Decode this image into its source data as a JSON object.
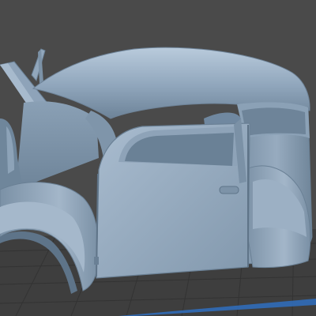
{
  "viewport": {
    "model": "car-body-shell",
    "colors": {
      "background": "#4a4a4a",
      "model_base": "#8ea3b9",
      "model_highlight": "#b6c8da",
      "model_shadow": "#5f7488",
      "build_plate": "#3f3f3f",
      "grid_lines": "#363636",
      "plate_edge": "#2f6fbf"
    }
  }
}
